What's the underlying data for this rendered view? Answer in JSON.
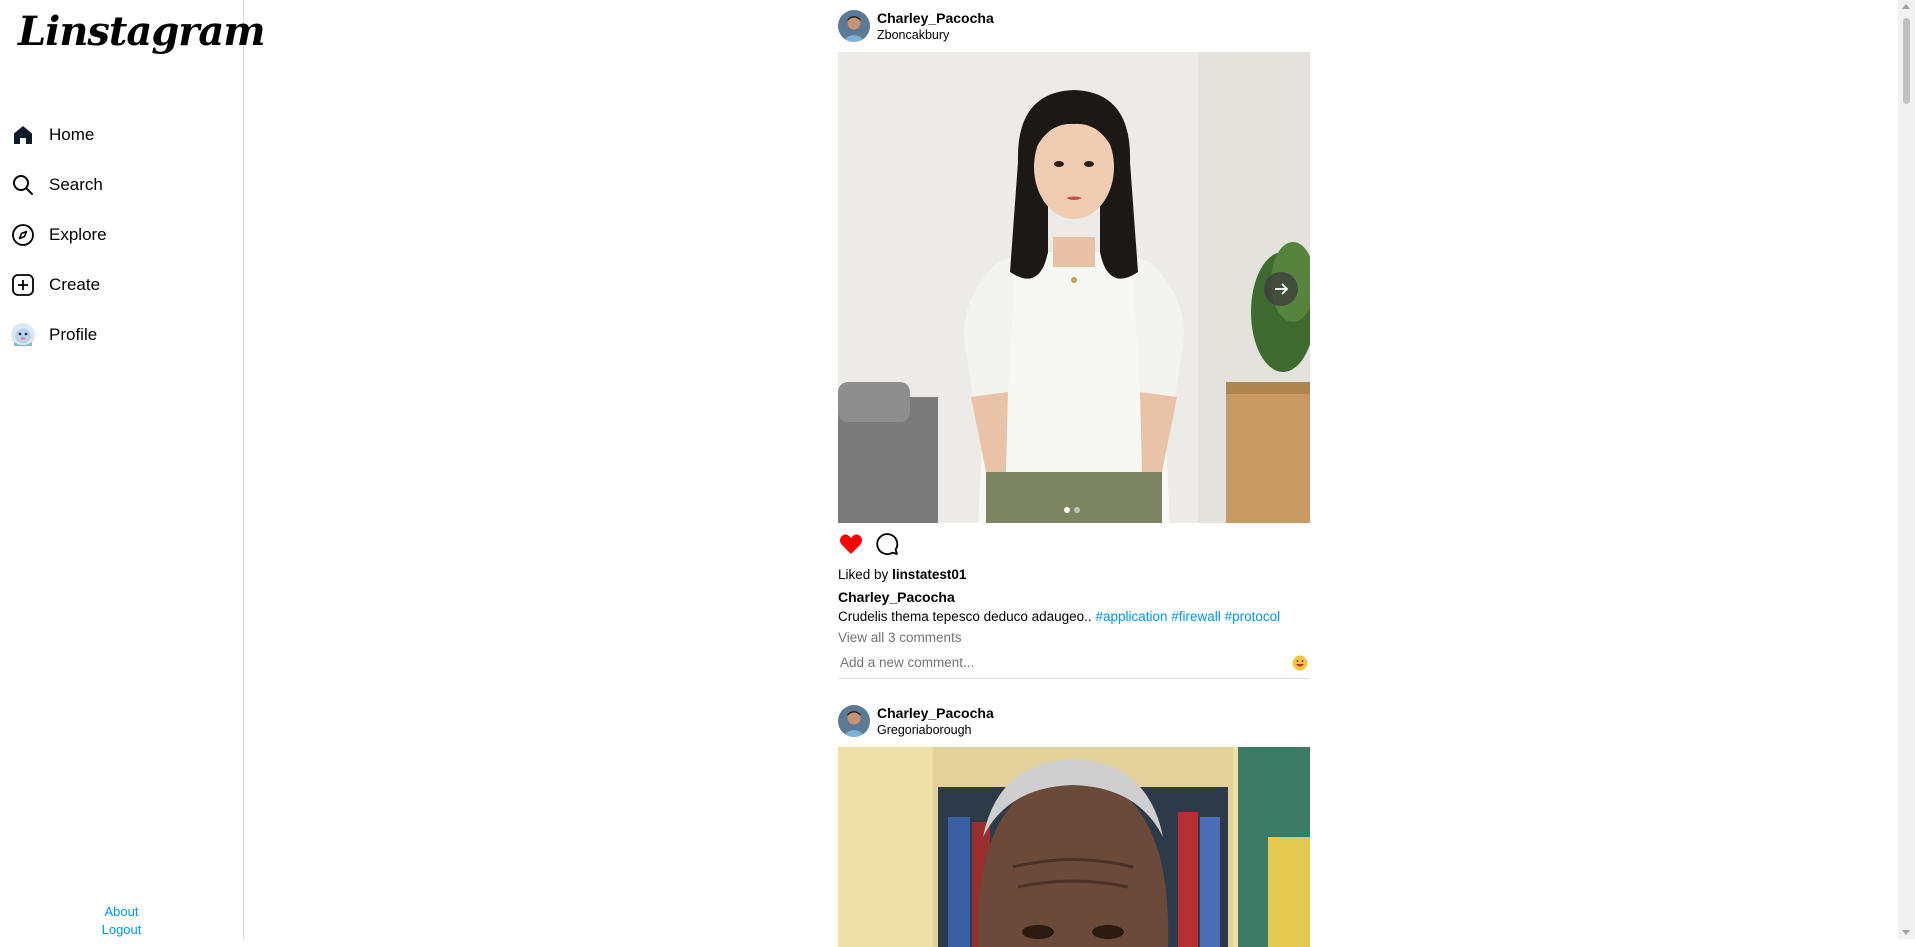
{
  "app": {
    "logo": "Linstagram"
  },
  "sidebar": {
    "items": [
      {
        "label": "Home",
        "icon": "home-icon"
      },
      {
        "label": "Search",
        "icon": "search-icon"
      },
      {
        "label": "Explore",
        "icon": "compass-icon"
      },
      {
        "label": "Create",
        "icon": "plus-square-icon"
      },
      {
        "label": "Profile",
        "icon": "avatar-icon"
      }
    ],
    "footer": {
      "about": "About",
      "logout": "Logout"
    }
  },
  "posts": [
    {
      "username": "Charley_Pacocha",
      "location": "Zboncakbury",
      "liked": true,
      "likes_prefix": "Liked by",
      "likes_user": "linstatest01",
      "caption_user": "Charley_Pacocha",
      "caption_text": "Crudelis thema tepesco deduco adaugeo..",
      "hashtags": [
        "#application",
        "#firewall",
        "#protocol"
      ],
      "view_comments": "View all 3 comments",
      "comment_placeholder": "Add a new comment...",
      "carousel": {
        "slides": 2,
        "current": 1
      }
    },
    {
      "username": "Charley_Pacocha",
      "location": "Gregoriaborough"
    }
  ],
  "colors": {
    "accent": "#0095f6",
    "like": "#ff0000",
    "border": "#dbdbdb",
    "muted": "#737373"
  }
}
